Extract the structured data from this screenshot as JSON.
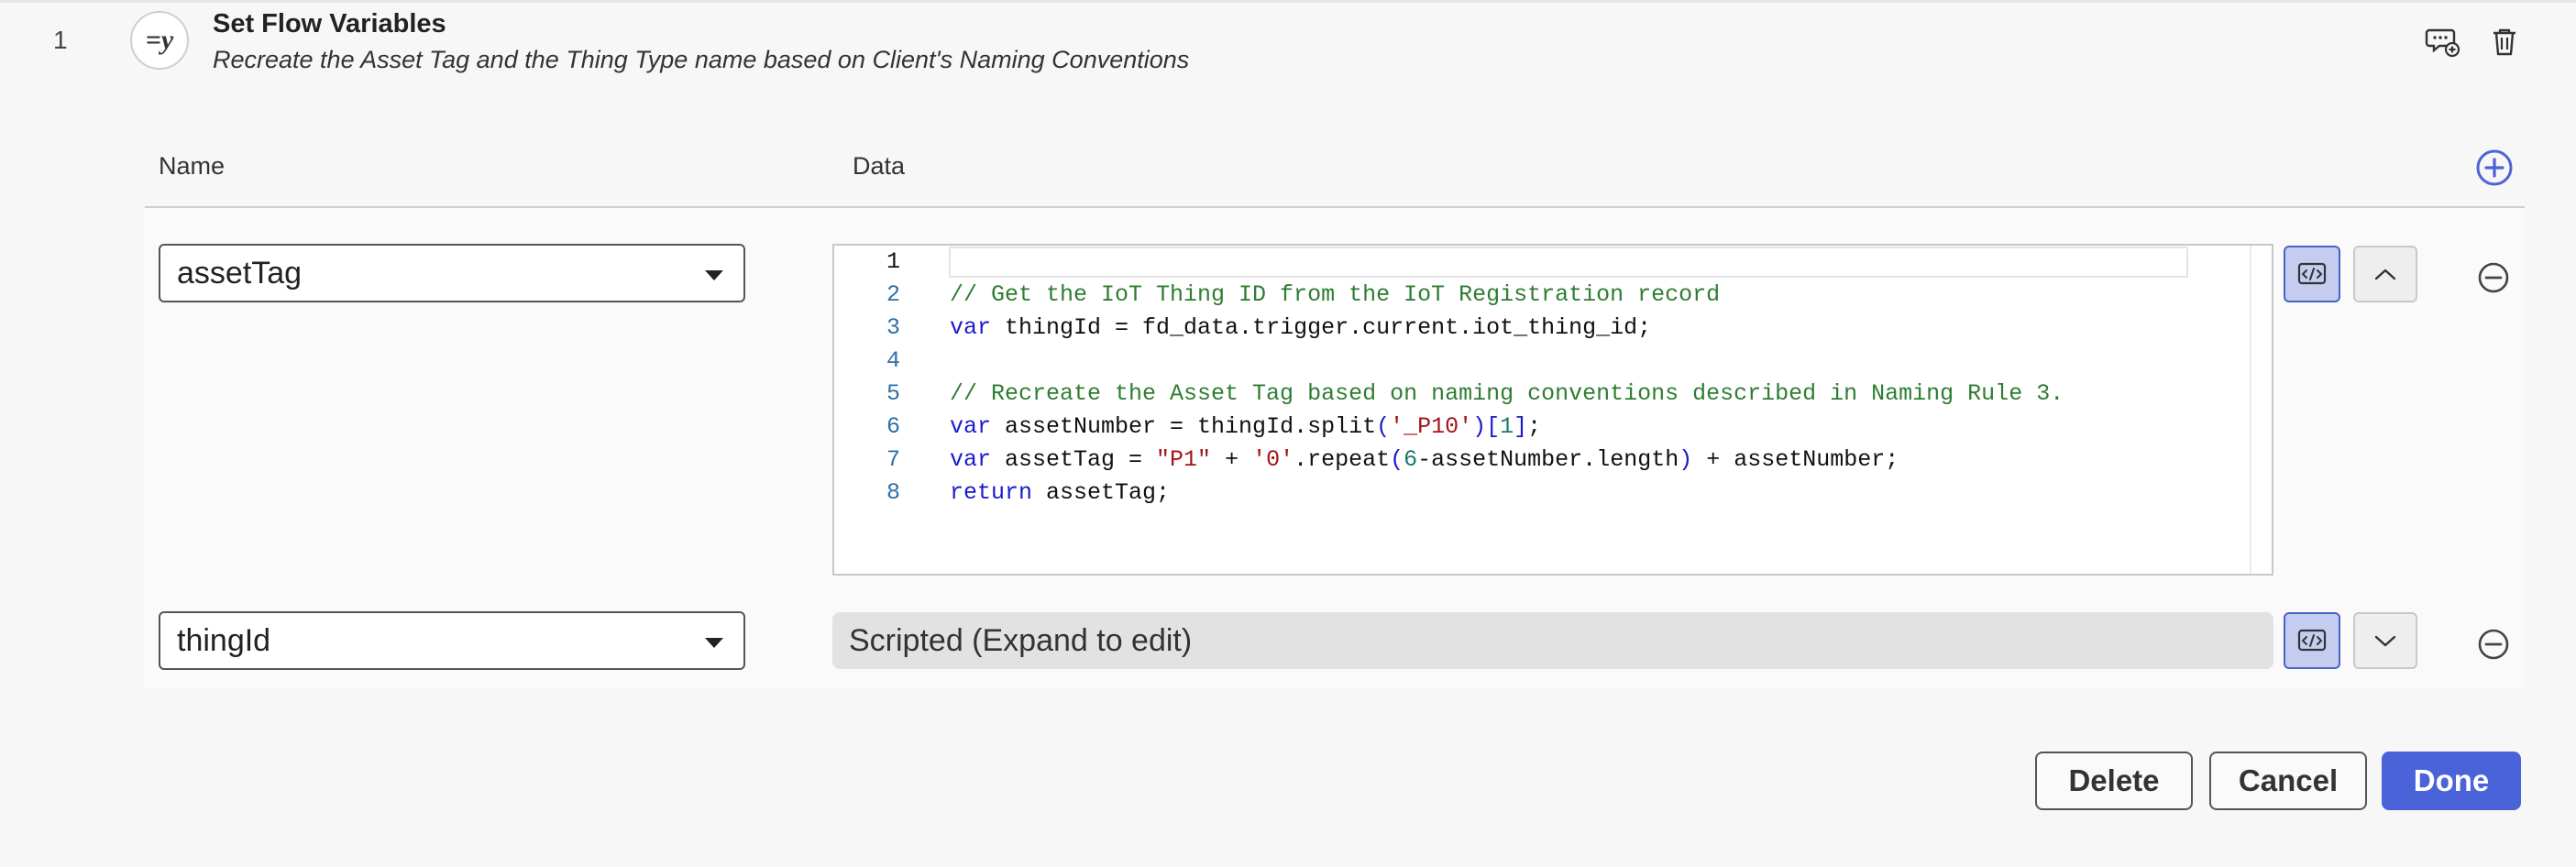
{
  "step": {
    "number": "1",
    "icon": "=y",
    "title": "Set Flow Variables",
    "description": "Recreate the Asset Tag and the Thing Type name based on Client's Naming Conventions"
  },
  "columns": {
    "name": "Name",
    "data": "Data"
  },
  "rows": [
    {
      "name": "assetTag",
      "script_lines": [
        {
          "num": "1",
          "tokens": []
        },
        {
          "num": "2",
          "tokens": [
            {
              "t": "c",
              "v": "// Get the IoT Thing ID from the IoT Registration record"
            }
          ]
        },
        {
          "num": "3",
          "tokens": [
            {
              "t": "k",
              "v": "var"
            },
            {
              "t": "x",
              "v": " thingId = fd_data.trigger.current.iot_thing_id;"
            }
          ]
        },
        {
          "num": "4",
          "tokens": []
        },
        {
          "num": "5",
          "tokens": [
            {
              "t": "c",
              "v": "// Recreate the Asset Tag based on naming conventions described in Naming Rule 3."
            }
          ]
        },
        {
          "num": "6",
          "tokens": [
            {
              "t": "k",
              "v": "var"
            },
            {
              "t": "x",
              "v": " assetNumber = thingId.split"
            },
            {
              "t": "p",
              "v": "("
            },
            {
              "t": "s",
              "v": "'_P10'"
            },
            {
              "t": "p",
              "v": ")["
            },
            {
              "t": "n",
              "v": "1"
            },
            {
              "t": "p",
              "v": "]"
            },
            {
              "t": "x",
              "v": ";"
            }
          ]
        },
        {
          "num": "7",
          "tokens": [
            {
              "t": "k",
              "v": "var"
            },
            {
              "t": "x",
              "v": " assetTag = "
            },
            {
              "t": "s",
              "v": "\"P1\""
            },
            {
              "t": "x",
              "v": " + "
            },
            {
              "t": "s",
              "v": "'0'"
            },
            {
              "t": "x",
              "v": ".repeat"
            },
            {
              "t": "p",
              "v": "("
            },
            {
              "t": "n",
              "v": "6"
            },
            {
              "t": "x",
              "v": "-assetNumber.length"
            },
            {
              "t": "p",
              "v": ")"
            },
            {
              "t": "x",
              "v": " + assetNumber;"
            }
          ]
        },
        {
          "num": "8",
          "tokens": [
            {
              "t": "k",
              "v": "return"
            },
            {
              "t": "x",
              "v": " assetTag;"
            }
          ]
        }
      ]
    },
    {
      "name": "thingId",
      "collapsed_text": "Scripted (Expand to edit)"
    }
  ],
  "icons": {
    "step": "flow-variable-icon",
    "comment": "add-comment-icon",
    "delete": "trash-icon",
    "add": "plus-circle-icon",
    "remove": "minus-circle-icon",
    "script": "script-toggle-icon",
    "collapse": "chevron-up-icon",
    "expand": "chevron-down-icon"
  },
  "footer": {
    "delete": "Delete",
    "cancel": "Cancel",
    "done": "Done"
  },
  "colors": {
    "primary": "#4a63d8",
    "script_toggle_bg": "#c4cdf0"
  }
}
